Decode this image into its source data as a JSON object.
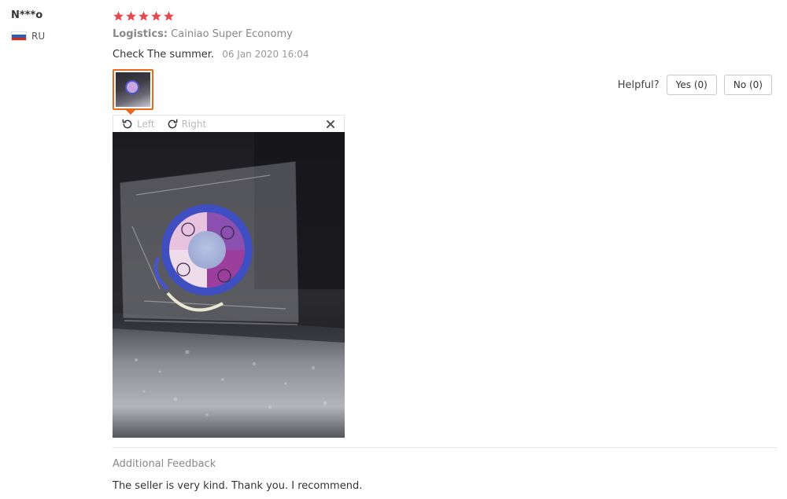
{
  "reviewer": {
    "name": "N***o",
    "country_code": "RU",
    "flag_colors": [
      "#ffffff",
      "#2f5fb3",
      "#d52b1e"
    ]
  },
  "rating": {
    "stars": 5,
    "max": 5,
    "color": "#e5474b"
  },
  "logistics": {
    "label": "Logistics:",
    "value": "Cainiao Super Economy"
  },
  "review": {
    "text": "Check The summer.",
    "date": "06 Jan 2020 16:04"
  },
  "helpful": {
    "label": "Helpful?",
    "yes": "Yes (0)",
    "no": "No (0)"
  },
  "image_viewer": {
    "rotate_left": "Left",
    "rotate_right": "Right",
    "icons": {
      "rotate_left": "rotate-left-icon",
      "rotate_right": "rotate-right-icon",
      "close": "close-icon"
    }
  },
  "additional_feedback": {
    "title": "Additional Feedback",
    "text": "The seller is very kind. Thank you. I recommend."
  },
  "colors": {
    "accent": "#e8691b",
    "star": "#e5474b"
  }
}
